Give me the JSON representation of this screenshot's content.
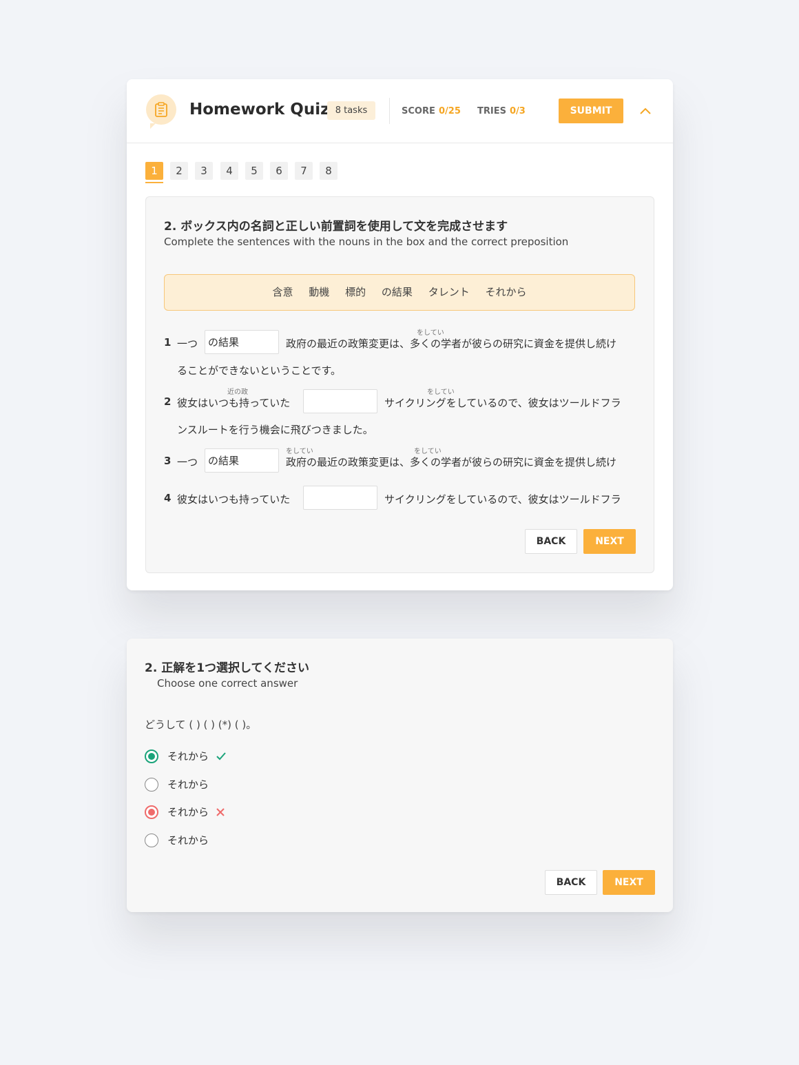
{
  "header": {
    "title": "Homework Quiz",
    "tasks_badge": "8 tasks",
    "score_label": "SCORE",
    "score_value": "0/25",
    "tries_label": "TRIES",
    "tries_value": "0/3",
    "submit_label": "SUBMIT",
    "icon": "clipboard-icon",
    "accent": "#fbb03b"
  },
  "pagination": {
    "pages": [
      "1",
      "2",
      "3",
      "4",
      "5",
      "6",
      "7",
      "8"
    ],
    "active": "1"
  },
  "task1": {
    "title": "2. ボックス内の名詞と正しい前置詞を使用して文を完成させます",
    "subtitle": "Complete the sentences with the nouns in the box and the correct preposition",
    "words": [
      "含意",
      "動機",
      "標的",
      "の結果",
      "タレント",
      "それから"
    ],
    "rows": [
      {
        "num": "1",
        "before": "一つ",
        "blank": "の結果",
        "after": "政府の最近の政策変更は、多くの学者が彼らの研究に資金を提供し続け",
        "cont": "ることができないということです。",
        "ruby_after": "をしてい"
      },
      {
        "num": "2",
        "before": "彼女はいつも持っていた",
        "blank": "",
        "after": "サイクリングをしているので、彼女はツールドフラ",
        "cont": "ンスルートを行う機会に飛びつきました。",
        "ruby_before": "近の政",
        "ruby_after": "をしてい"
      },
      {
        "num": "3",
        "before": "一つ",
        "blank": "の結果",
        "after": "政府の最近の政策変更は、多くの学者が彼らの研究に資金を提供し続け",
        "ruby_after1": "をしてい",
        "ruby_after2": "をしてい"
      },
      {
        "num": "4",
        "before": "彼女はいつも持っていた",
        "blank": "",
        "after": "サイクリングをしているので、彼女はツールドフラ"
      }
    ],
    "back_label": "BACK",
    "next_label": "NEXT"
  },
  "task2": {
    "title": "2. 正解を1つ選択してください",
    "subtitle": "Choose one correct answer",
    "prompt": "どうして ( ) ( ) (*) ( )。",
    "options": [
      {
        "label": "それから",
        "state": "correct"
      },
      {
        "label": "それから",
        "state": "none"
      },
      {
        "label": "それから",
        "state": "wrong"
      },
      {
        "label": "それから",
        "state": "none"
      }
    ],
    "back_label": "BACK",
    "next_label": "NEXT",
    "correct_color": "#1aa37a",
    "wrong_color": "#ef6b6b"
  }
}
